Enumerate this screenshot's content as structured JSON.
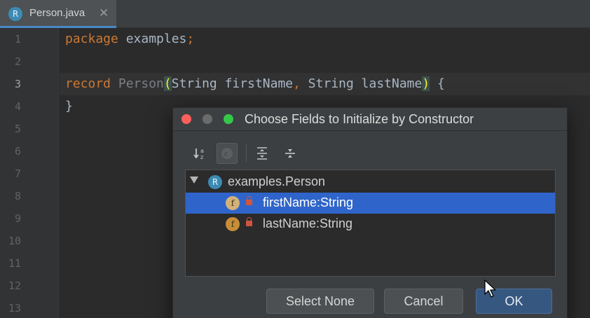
{
  "tab": {
    "icon": "record-icon",
    "icon_letter": "R",
    "label": "Person.java",
    "close_glyph": "✕"
  },
  "editor": {
    "line_numbers": [
      "1",
      "2",
      "3",
      "4",
      "5",
      "6",
      "7",
      "8",
      "9",
      "10",
      "11",
      "12",
      "13"
    ],
    "active_line": "3",
    "lines": {
      "l1_kw": "package",
      "l1_rest": " examples",
      "l1_semi": ";",
      "l3_kw": "record",
      "l3_name": " Person",
      "l3_open": "(",
      "l3_params_a": "String firstName",
      "l3_comma": ",",
      "l3_params_b": " String lastName",
      "l3_close": ")",
      "l3_brace": " {",
      "l4": "}"
    }
  },
  "dialog": {
    "title": "Choose Fields to Initialize by Constructor",
    "toolbar": {
      "sort_icon": "sort-alphabetically-icon",
      "show_classes_icon": "show-classes-icon",
      "expand_all_icon": "expand-all-icon",
      "collapse_all_icon": "collapse-all-icon"
    },
    "tree": {
      "root": {
        "icon": "record-icon",
        "icon_letter": "R",
        "label": "examples.Person"
      },
      "fields": [
        {
          "icon": "field-icon",
          "icon_letter": "f",
          "label": "firstName:String",
          "selected": true
        },
        {
          "icon": "field-icon",
          "icon_letter": "f",
          "label": "lastName:String",
          "selected": false
        }
      ]
    },
    "buttons": {
      "select_none": "Select None",
      "cancel": "Cancel",
      "ok": "OK"
    }
  },
  "colors": {
    "keyword": "#cc7832",
    "selection": "#2f65ca",
    "primary_button": "#365880",
    "brace_highlight": "#ffef28"
  }
}
